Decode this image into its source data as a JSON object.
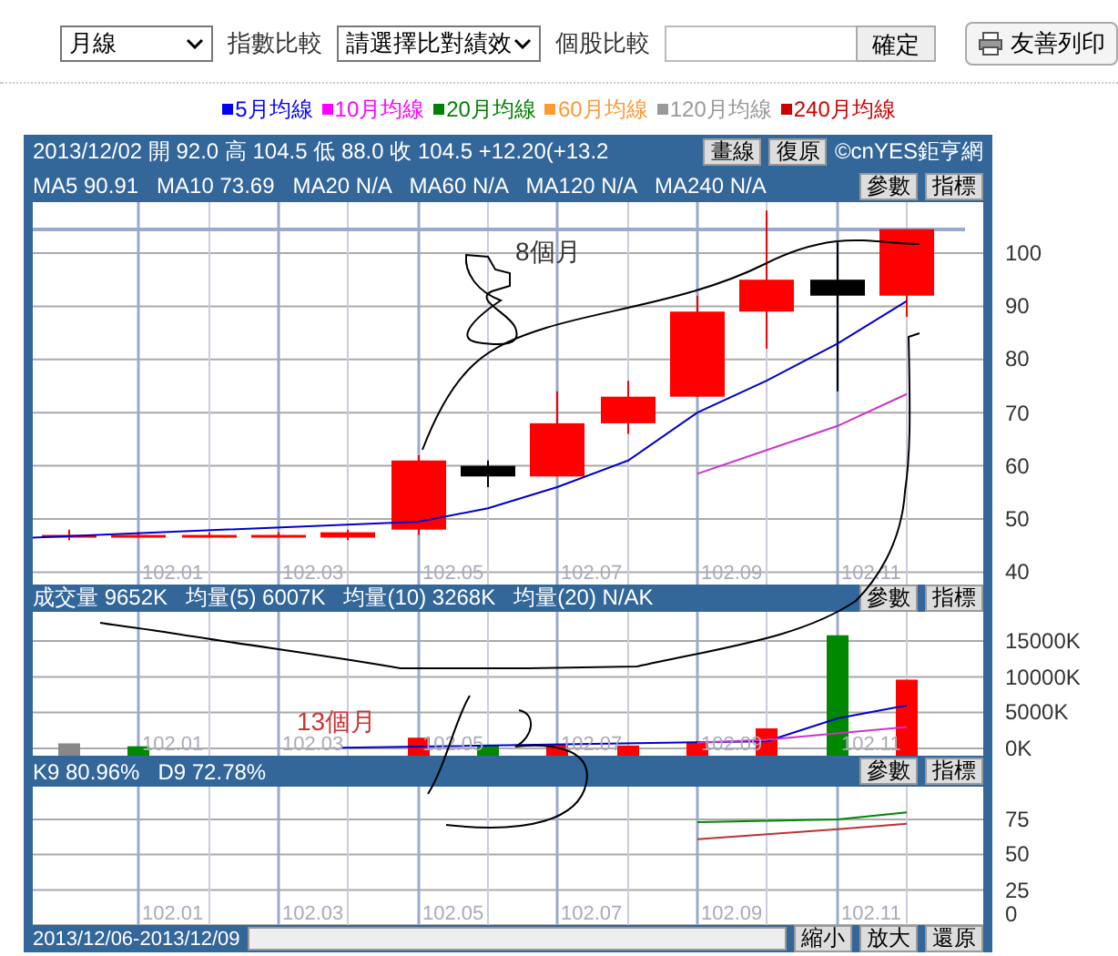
{
  "toolbar": {
    "period_select": {
      "value": "月線"
    },
    "index_label": "指數比較",
    "index_select": {
      "value": "請選擇比對績效"
    },
    "stock_label": "個股比較",
    "confirm_button": "確定",
    "print_button": "友善列印"
  },
  "legend": [
    {
      "label": "5月均線",
      "color": "#0000ff"
    },
    {
      "label": "10月均線",
      "color": "#ff00ff"
    },
    {
      "label": "20月均線",
      "color": "#008000"
    },
    {
      "label": "60月均線",
      "color": "#ff9933"
    },
    {
      "label": "120月均線",
      "color": "#999999"
    },
    {
      "label": "240月均線",
      "color": "#cc0000"
    }
  ],
  "chart": {
    "quote": "2013/12/02 開 92.0 高 104.5 低 88.0 收 104.5 +12.20(+13.2",
    "tool_buttons": [
      "畫線",
      "復原"
    ],
    "copyright": "©cnYES鉅亨網",
    "price_panel": {
      "summary": "MA5 90.91   MA10 73.69   MA20 N/A   MA60 N/A   MA120 N/A   MA240 N/A",
      "buttons": [
        "參數",
        "指標"
      ],
      "y_labels": [
        "100",
        "90",
        "80",
        "70",
        "60",
        "50",
        "40"
      ],
      "x_labels": [
        "102.01",
        "102.03",
        "102.05",
        "102.07",
        "102.09",
        "102.11"
      ]
    },
    "volume_panel": {
      "summary": "成交量 9652K   均量(5) 6007K   均量(10) 3268K   均量(20) N/AK",
      "buttons": [
        "參數",
        "指標"
      ],
      "y_labels": [
        "15000K",
        "10000K",
        "5000K",
        "0K"
      ],
      "x_labels": [
        "102.01",
        "102.03",
        "102.05",
        "102.07",
        "102.09",
        "102.11"
      ]
    },
    "kd_panel": {
      "summary": "K9 80.96%   D9 72.78%",
      "buttons": [
        "參數",
        "指標"
      ],
      "y_labels": [
        "75",
        "50",
        "25",
        "0"
      ],
      "x_labels": [
        "102.01",
        "102.03",
        "102.05",
        "102.07",
        "102.09",
        "102.11"
      ]
    }
  },
  "annotations": [
    {
      "text": "8個月",
      "color": "#333333"
    },
    {
      "text": "13個月",
      "color": "#cc3333"
    }
  ],
  "footer": {
    "date_range": "2013/12/06-2013/12/09",
    "buttons": [
      "縮小",
      "放大",
      "還原"
    ]
  }
}
